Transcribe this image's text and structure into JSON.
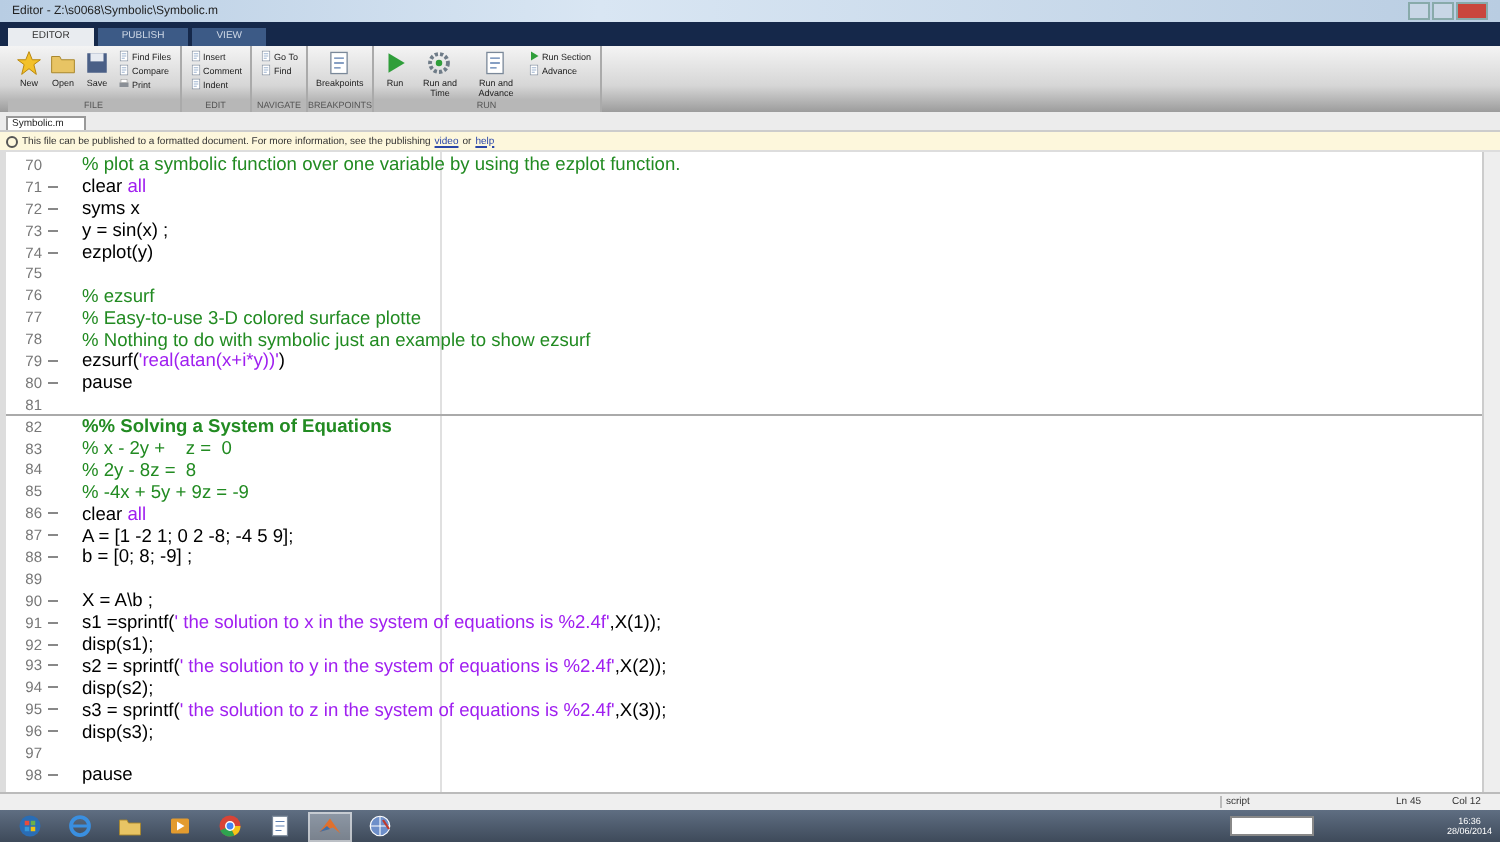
{
  "window": {
    "title": "Editor - Z:\\s0068\\Symbolic\\Symbolic.m"
  },
  "tabs": [
    {
      "label": "EDITOR",
      "selected": true
    },
    {
      "label": "PUBLISH",
      "selected": false
    },
    {
      "label": "VIEW",
      "selected": false
    }
  ],
  "toolstrip": [
    {
      "label": "FILE",
      "tools": [
        {
          "label": "New",
          "kind": "big"
        },
        {
          "label": "Open",
          "kind": "big"
        },
        {
          "label": "Save",
          "kind": "big"
        },
        {
          "label": "Find Files",
          "kind": "small"
        },
        {
          "label": "Compare",
          "kind": "small"
        },
        {
          "label": "Print",
          "kind": "small"
        }
      ]
    },
    {
      "label": "EDIT",
      "tools": [
        {
          "label": "Insert",
          "kind": "small"
        },
        {
          "label": "Comment",
          "kind": "small"
        },
        {
          "label": "Indent",
          "kind": "small"
        }
      ]
    },
    {
      "label": "NAVIGATE",
      "tools": [
        {
          "label": "Go To",
          "kind": "small"
        },
        {
          "label": "Find",
          "kind": "small"
        }
      ]
    },
    {
      "label": "BREAKPOINTS",
      "tools": [
        {
          "label": "Breakpoints",
          "kind": "big"
        }
      ]
    },
    {
      "label": "RUN",
      "tools": [
        {
          "label": "Run",
          "kind": "big"
        },
        {
          "label": "Run and Time",
          "kind": "big"
        },
        {
          "label": "Run and Advance",
          "kind": "big"
        },
        {
          "label": "Run Section",
          "kind": "small"
        },
        {
          "label": "Advance",
          "kind": "small"
        }
      ]
    }
  ],
  "file_tabs": [
    {
      "label": "Symbolic.m",
      "selected": true
    }
  ],
  "info_bar": {
    "text": "This file can be published to a formatted document. For more information, see the publishing",
    "links": [
      "video",
      "help"
    ],
    "joiner": "or"
  },
  "editor": {
    "lines": [
      {
        "number": "70",
        "executable": false,
        "section": false,
        "tokens": [
          {
            "kind": "comment",
            "text": "% plot a symbolic function over one variable by using the ezplot function."
          }
        ]
      },
      {
        "number": "71",
        "executable": true,
        "section": false,
        "tokens": [
          {
            "kind": "code",
            "text": "clear "
          },
          {
            "kind": "string",
            "text": "all"
          }
        ]
      },
      {
        "number": "72",
        "executable": true,
        "section": false,
        "tokens": [
          {
            "kind": "code",
            "text": "syms x"
          }
        ]
      },
      {
        "number": "73",
        "executable": true,
        "section": false,
        "tokens": [
          {
            "kind": "code",
            "text": "y = sin(x) ;"
          }
        ]
      },
      {
        "number": "74",
        "executable": true,
        "section": false,
        "tokens": [
          {
            "kind": "code",
            "text": "ezplot(y)"
          }
        ]
      },
      {
        "number": "75",
        "executable": false,
        "section": false
      },
      {
        "number": "76",
        "executable": false,
        "section": false,
        "tokens": [
          {
            "kind": "comment",
            "text": "% ezsurf"
          }
        ]
      },
      {
        "number": "77",
        "executable": false,
        "section": false,
        "tokens": [
          {
            "kind": "comment",
            "text": "% Easy-to-use 3-D colored surface plotte"
          }
        ]
      },
      {
        "number": "78",
        "executable": false,
        "section": false,
        "tokens": [
          {
            "kind": "comment",
            "text": "% Nothing to do with symbolic just an example to show ezsurf"
          }
        ]
      },
      {
        "number": "79",
        "executable": true,
        "section": false,
        "tokens": [
          {
            "kind": "code",
            "text": "ezsurf("
          },
          {
            "kind": "string",
            "text": "'real(atan(x+i*y))'"
          },
          {
            "kind": "code",
            "text": ")"
          }
        ]
      },
      {
        "number": "80",
        "executable": true,
        "section": false,
        "tokens": [
          {
            "kind": "code",
            "text": "pause"
          }
        ]
      },
      {
        "number": "81",
        "executable": false,
        "section": false
      },
      {
        "number": "82",
        "executable": false,
        "section": true,
        "tokens": [
          {
            "kind": "section",
            "text": "%% Solving a System of Equations"
          }
        ]
      },
      {
        "number": "83",
        "executable": false,
        "section": false,
        "tokens": [
          {
            "kind": "comment",
            "text": "% x - 2y +    z =  0"
          }
        ]
      },
      {
        "number": "84",
        "executable": false,
        "section": false,
        "tokens": [
          {
            "kind": "comment",
            "text": "% 2y - 8z =  8"
          }
        ]
      },
      {
        "number": "85",
        "executable": false,
        "section": false,
        "tokens": [
          {
            "kind": "comment",
            "text": "% -4x + 5y + 9z = -9"
          }
        ]
      },
      {
        "number": "86",
        "executable": true,
        "section": false,
        "tokens": [
          {
            "kind": "code",
            "text": "clear "
          },
          {
            "kind": "string",
            "text": "all"
          }
        ]
      },
      {
        "number": "87",
        "executable": true,
        "section": false,
        "tokens": [
          {
            "kind": "code",
            "text": "A = [1 -2 1; 0 2 -8; -4 5 9];"
          }
        ]
      },
      {
        "number": "88",
        "executable": true,
        "section": false,
        "tokens": [
          {
            "kind": "code",
            "text": "b = [0; 8; -9] ;"
          }
        ]
      },
      {
        "number": "89",
        "executable": false,
        "section": false
      },
      {
        "number": "90",
        "executable": true,
        "section": false,
        "tokens": [
          {
            "kind": "code",
            "text": "X = A\\b ;"
          }
        ]
      },
      {
        "number": "91",
        "executable": true,
        "section": false,
        "tokens": [
          {
            "kind": "code",
            "text": "s1 =sprintf("
          },
          {
            "kind": "string",
            "text": "' the solution to x in the system of equations is %2.4f'"
          },
          {
            "kind": "code",
            "text": ",X(1));"
          }
        ]
      },
      {
        "number": "92",
        "executable": true,
        "section": false,
        "tokens": [
          {
            "kind": "code",
            "text": "disp(s1);"
          }
        ]
      },
      {
        "number": "93",
        "executable": true,
        "section": false,
        "tokens": [
          {
            "kind": "code",
            "text": "s2 = sprintf("
          },
          {
            "kind": "string",
            "text": "' the solution to y in the system of equations is %2.4f'"
          },
          {
            "kind": "code",
            "text": ",X(2));"
          }
        ]
      },
      {
        "number": "94",
        "executable": true,
        "section": false,
        "tokens": [
          {
            "kind": "code",
            "text": "disp(s2);"
          }
        ]
      },
      {
        "number": "95",
        "executable": true,
        "section": false,
        "tokens": [
          {
            "kind": "code",
            "text": "s3 = sprintf("
          },
          {
            "kind": "string",
            "text": "' the solution to z in the system of equations is %2.4f'"
          },
          {
            "kind": "code",
            "text": ",X(3));"
          }
        ]
      },
      {
        "number": "96",
        "executable": true,
        "section": false,
        "tokens": [
          {
            "kind": "code",
            "text": "disp(s3);"
          }
        ]
      },
      {
        "number": "97",
        "executable": false,
        "section": false
      },
      {
        "number": "98",
        "executable": true,
        "section": false,
        "tokens": [
          {
            "kind": "code",
            "text": "pause"
          }
        ]
      }
    ]
  },
  "status_bar": {
    "mode": "script",
    "line": "Ln 45",
    "column": "Col 12"
  },
  "taskbar": {
    "apps": [
      {
        "selected": false
      },
      {
        "selected": false
      },
      {
        "selected": false
      },
      {
        "selected": false
      },
      {
        "selected": false
      },
      {
        "selected": false
      },
      {
        "selected": true
      },
      {
        "selected": false
      }
    ],
    "time": "16:36",
    "date": "28/06/2014"
  }
}
